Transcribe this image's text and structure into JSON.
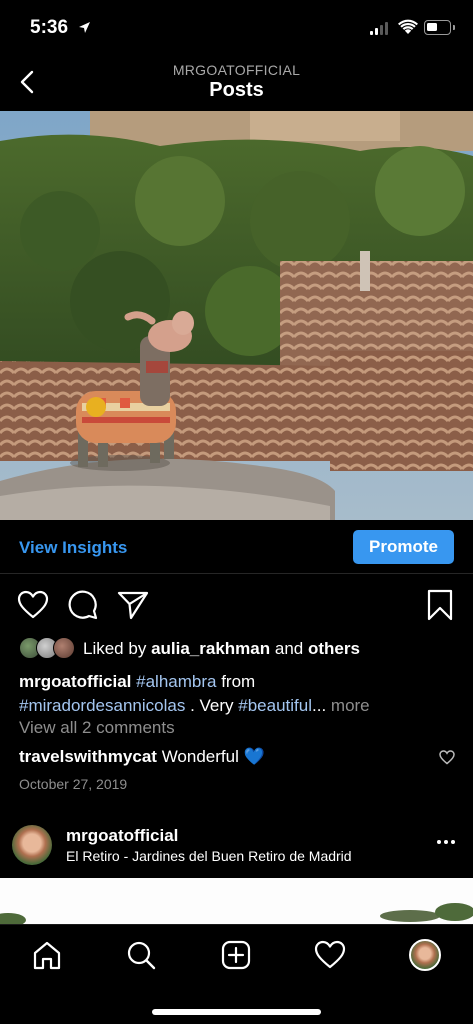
{
  "status_bar": {
    "time": "5:36"
  },
  "header": {
    "username": "MRGOATOFFICIAL",
    "title": "Posts"
  },
  "insights": {
    "view_insights": "View Insights",
    "promote": "Promote"
  },
  "likes": {
    "prefix": "Liked by",
    "user": "aulia_rakhman",
    "and": "and",
    "others": "others"
  },
  "caption": {
    "username": "mrgoatofficial",
    "tag1": "#alhambra",
    "text1": "from",
    "tag2": "#miradordesannicolas",
    "text2": ". Very",
    "tag3": "#beautiful",
    "ellipsis": "...",
    "more": "more"
  },
  "comments": {
    "view_all": "View all 2 comments",
    "commenter": "travelswithmycat",
    "text": "Wonderful",
    "emoji": "💙"
  },
  "date": "October 27, 2019",
  "next_post": {
    "username": "mrgoatofficial",
    "location": "El Retiro - Jardines del Buen Retiro de Madrid"
  },
  "colors": {
    "accent": "#3897f0",
    "hashtag": "#a4c6f0",
    "muted": "#8e8e8e",
    "background": "#000000"
  },
  "icons": [
    "location-arrow-icon",
    "signal-icon",
    "wifi-icon",
    "battery-icon",
    "back-chevron-icon",
    "heart-icon",
    "comment-icon",
    "share-icon",
    "bookmark-icon",
    "more-dots-icon",
    "home-icon",
    "search-icon",
    "add-post-icon",
    "activity-heart-icon",
    "profile-avatar"
  ]
}
